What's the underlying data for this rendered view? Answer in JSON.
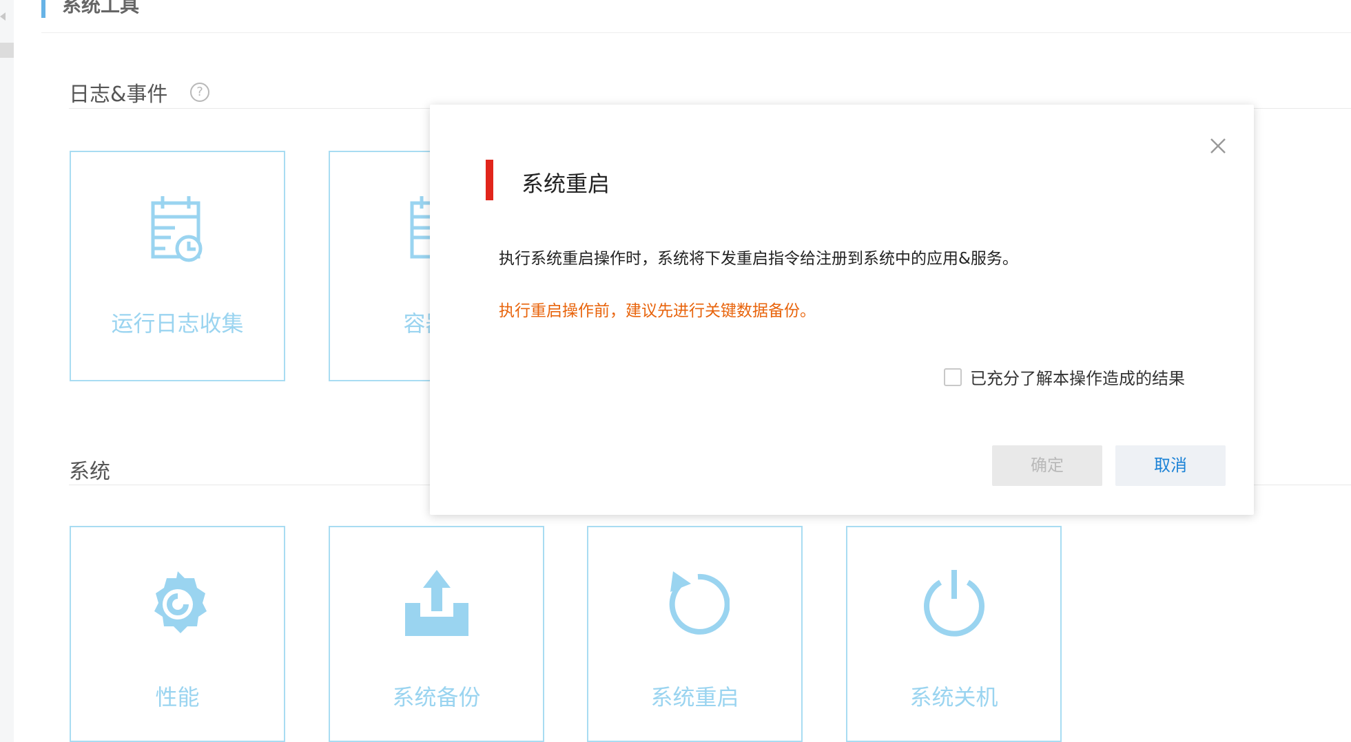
{
  "page": {
    "title": "系统工具"
  },
  "sections": {
    "logs": {
      "title": "日志&事件",
      "help_icon": "help-circle-icon"
    },
    "system": {
      "title": "系统"
    }
  },
  "log_cards": [
    {
      "label": "运行日志收集",
      "icon": "log-clock-icon"
    },
    {
      "label": "容器日",
      "icon": "log-icon"
    }
  ],
  "system_cards": [
    {
      "label": "性能",
      "icon": "performance-gear-icon"
    },
    {
      "label": "系统备份",
      "icon": "backup-upload-icon"
    },
    {
      "label": "系统重启",
      "icon": "restart-icon"
    },
    {
      "label": "系统关机",
      "icon": "power-icon"
    }
  ],
  "dialog": {
    "title": "系统重启",
    "message": "执行系统重启操作时，系统将下发重启指令给注册到系统中的应用&服务。",
    "warning": "执行重启操作前，建议先进行关键数据备份。",
    "confirm_label": "已充分了解本操作造成的结果",
    "ok_label": "确定",
    "cancel_label": "取消",
    "close_icon": "close-icon"
  },
  "colors": {
    "accent": "#e1251b",
    "warning": "#e8640c",
    "card_border": "#a8dcf2",
    "card_text": "#9ad4f0",
    "link_blue": "#1b82d6"
  }
}
